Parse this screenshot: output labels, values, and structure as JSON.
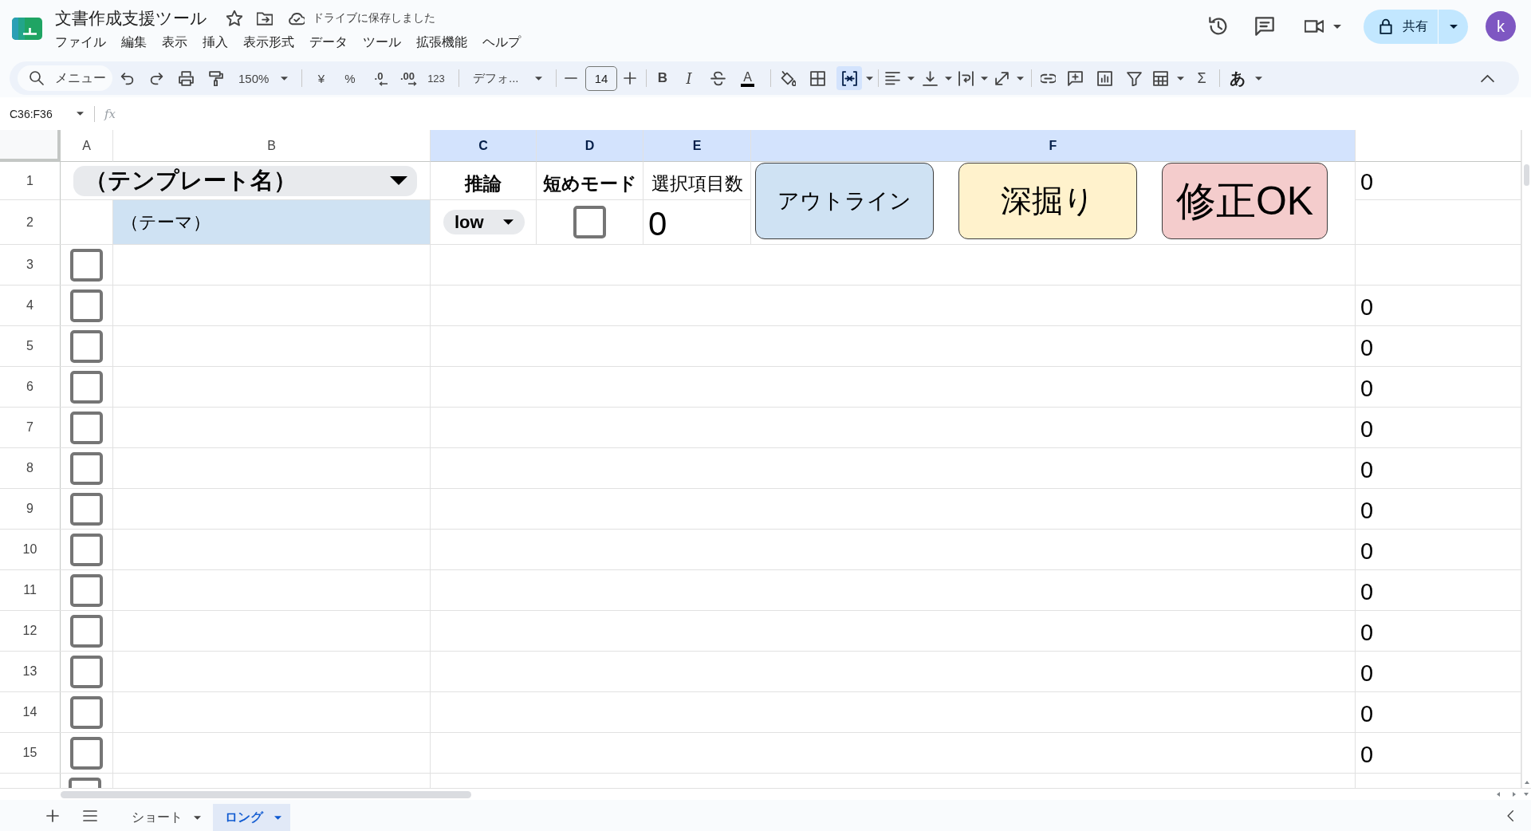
{
  "document": {
    "title": "文書作成支援ツール",
    "save_status": "ドライブに保存しました"
  },
  "menu": [
    "ファイル",
    "編集",
    "表示",
    "挿入",
    "表示形式",
    "データ",
    "ツール",
    "拡張機能",
    "ヘルプ"
  ],
  "share_button": {
    "label": "共有"
  },
  "account": {
    "initial": "k"
  },
  "toolbar": {
    "search": {
      "placeholder": "メニュー"
    },
    "zoom": "150%",
    "currency": "¥",
    "percent": "%",
    "decrease_decimal": ".0",
    "increase_decimal": ".00",
    "number_format": "123",
    "font": "デフォ...",
    "font_size": "14",
    "bold": "B",
    "italic": "I",
    "text_color": "A",
    "merge_cells": {
      "selected": true
    },
    "functions": "Σ",
    "input_tools": "あ"
  },
  "formula_bar": {
    "name_box": "C36:F36",
    "function_label": "fx"
  },
  "columns": [
    {
      "label": "A",
      "selected": false
    },
    {
      "label": "B",
      "selected": false
    },
    {
      "label": "C",
      "selected": true
    },
    {
      "label": "D",
      "selected": true
    },
    {
      "label": "E",
      "selected": true
    },
    {
      "label": "F",
      "selected": true
    },
    {
      "selected": false
    }
  ],
  "row_1": {
    "number": "1",
    "template_dropdown": "（テンプレート名）",
    "reasoning_label": "推論",
    "short_mode_label": "短めモード",
    "count_label": "選択項目数",
    "column_g": "0"
  },
  "row_2": {
    "number": "2",
    "theme": "（テーマ）",
    "reasoning": "low",
    "short_mode": {
      "checked": false
    },
    "count": "0"
  },
  "buttons": [
    {
      "label": "アウトライン",
      "color": "#cfe2f3"
    },
    {
      "label": "深掘り",
      "color": "#fff2cc"
    },
    {
      "label": "修正OK",
      "color": "#f4cccc"
    }
  ],
  "rows": [
    {
      "number": "3",
      "checked": false
    },
    {
      "number": "4",
      "checked": false,
      "column_g": "0"
    },
    {
      "number": "5",
      "checked": false,
      "column_g": "0"
    },
    {
      "number": "6",
      "checked": false,
      "column_g": "0"
    },
    {
      "number": "7",
      "checked": false,
      "column_g": "0"
    },
    {
      "number": "8",
      "checked": false,
      "column_g": "0"
    },
    {
      "number": "9",
      "checked": false,
      "column_g": "0"
    },
    {
      "number": "10",
      "checked": false,
      "column_g": "0"
    },
    {
      "number": "11",
      "checked": false,
      "column_g": "0"
    },
    {
      "number": "12",
      "checked": false,
      "column_g": "0"
    },
    {
      "number": "13",
      "checked": false,
      "column_g": "0"
    },
    {
      "number": "14",
      "checked": false,
      "column_g": "0"
    },
    {
      "number": "15",
      "checked": false,
      "column_g": "0"
    },
    {
      "checked": false
    }
  ],
  "sheet_tabs": [
    {
      "label": "ショート",
      "selected": false
    },
    {
      "label": "ロング",
      "selected": true
    }
  ]
}
